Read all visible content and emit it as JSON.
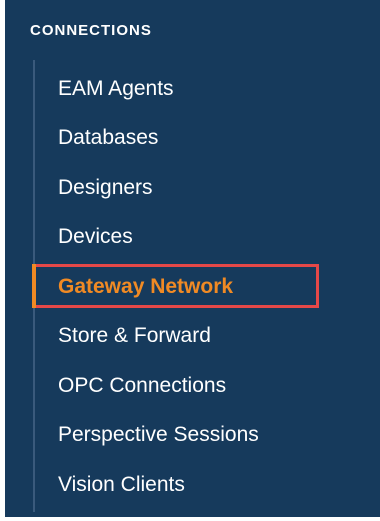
{
  "sidebar": {
    "header": "CONNECTIONS",
    "items": [
      {
        "label": "EAM Agents",
        "active": false
      },
      {
        "label": "Databases",
        "active": false
      },
      {
        "label": "Designers",
        "active": false
      },
      {
        "label": "Devices",
        "active": false
      },
      {
        "label": "Gateway Network",
        "active": true
      },
      {
        "label": "Store & Forward",
        "active": false
      },
      {
        "label": "OPC Connections",
        "active": false
      },
      {
        "label": "Perspective Sessions",
        "active": false
      },
      {
        "label": "Vision Clients",
        "active": false
      }
    ]
  },
  "colors": {
    "panel_bg": "#163a5c",
    "text": "#ffffff",
    "active_text": "#f08a24",
    "highlight_border": "#e64848"
  }
}
